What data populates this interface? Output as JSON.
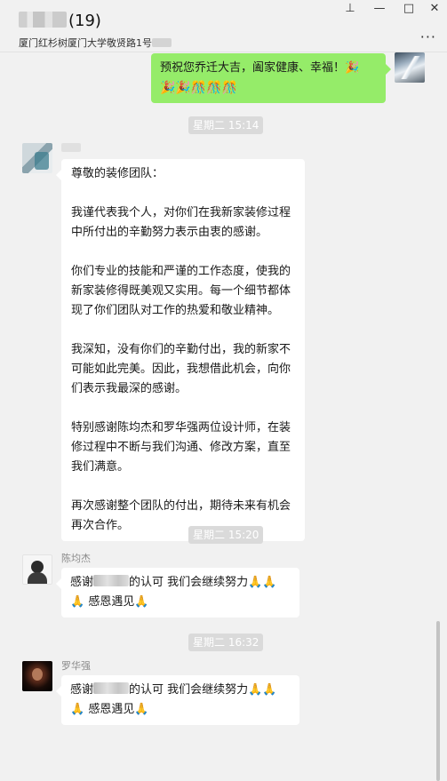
{
  "window": {
    "title_count": "(19)",
    "subtitle": "厦门红杉树厦门大学敬贤路1号",
    "controls": {
      "pin": "⊥",
      "minimize": "—",
      "maximize": "□",
      "close": "✕",
      "more": "···"
    }
  },
  "messages": {
    "outgoing": {
      "line1": "预祝您乔迁大吉，阖家健康、幸福！🎉",
      "line2": "🎉🎉🎊🎊🎊"
    },
    "time1": "星期二 15:14",
    "long_letter": {
      "paragraphs": [
        "尊敬的装修团队：",
        "我谨代表我个人，对你们在我新家装修过程中所付出的辛勤努力表示由衷的感谢。",
        "你们专业的技能和严谨的工作态度，使我的新家装修得既美观又实用。每一个细节都体现了你们团队对工作的热爱和敬业精神。",
        "我深知，没有你们的辛勤付出，我的新家不可能如此完美。因此，我想借此机会，向你们表示我最深的感谢。",
        "特别感谢陈均杰和罗华强两位设计师，在装修过程中不断与我们沟通、修改方案，直至我们满意。",
        "再次感谢整个团队的付出，期待未来有机会再次合作。"
      ]
    },
    "time2": "星期二 15:20",
    "sender2": "陈均杰",
    "reply1": {
      "prefix": "感谢",
      "suffix": "的认可    我们会继续努力🙏🙏",
      "line2": "🙏    感恩遇见🙏"
    },
    "time3": "星期二 16:32",
    "sender3": "罗华强",
    "reply2": {
      "prefix": "感谢",
      "suffix": "的认可    我们会继续努力🙏🙏",
      "line2": "🙏    感恩遇见🙏"
    }
  }
}
